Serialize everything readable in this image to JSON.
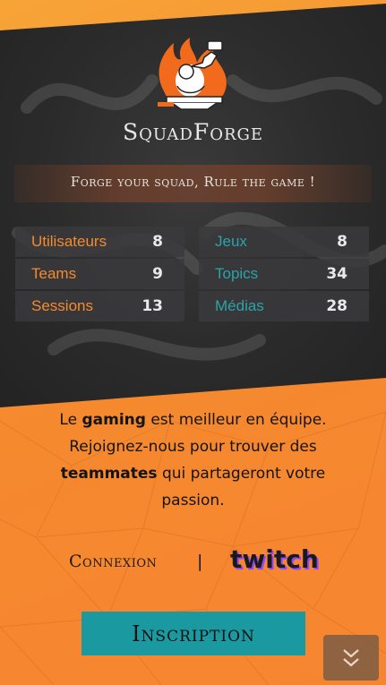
{
  "brand": {
    "name": "SquadForge"
  },
  "tagline": "Forge your squad, Rule the game !",
  "stats": {
    "left": [
      {
        "label": "Utilisateurs",
        "value": "8"
      },
      {
        "label": "Teams",
        "value": "9"
      },
      {
        "label": "Sessions",
        "value": "13"
      }
    ],
    "right": [
      {
        "label": "Jeux",
        "value": "8"
      },
      {
        "label": "Topics",
        "value": "34"
      },
      {
        "label": "Médias",
        "value": "28"
      }
    ]
  },
  "intro": {
    "p1": "Le ",
    "b1": "gaming",
    "p2": " est meilleur en équipe. Rejoignez-nous pour trouver des ",
    "b2": "teammates",
    "p3": " qui partageront votre passion."
  },
  "auth": {
    "connexion_label": "Connexion",
    "separator": "|",
    "twitch_logo_text": "twitch"
  },
  "cta": {
    "inscription_label": "Inscription"
  },
  "scroll": {
    "icon": "double-chevron-down-icon"
  },
  "colors": {
    "orange": "#f58a2e",
    "teal": "#1a9aa0",
    "dark": "#2b2b2b",
    "twitch_purple": "#9146ff"
  }
}
